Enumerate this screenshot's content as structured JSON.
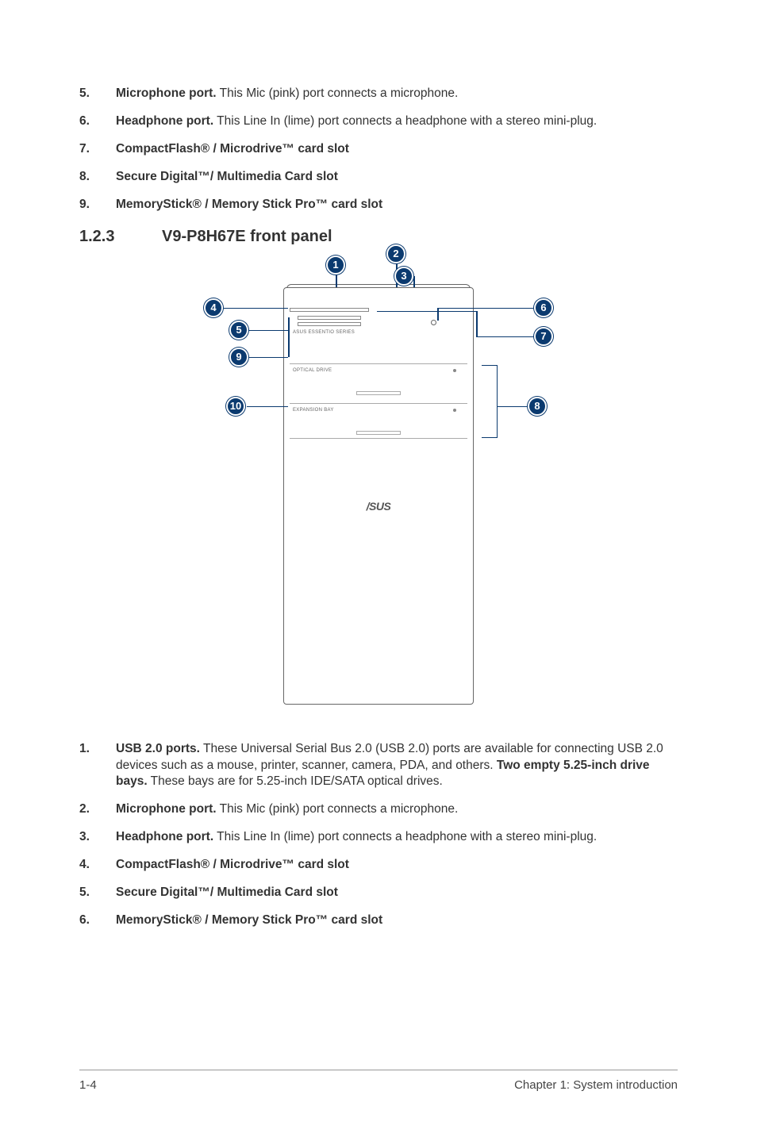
{
  "top_items": [
    {
      "num": "5.",
      "bold": "Microphone port.",
      "rest": " This Mic (pink) port connects a microphone."
    },
    {
      "num": "6.",
      "bold": "Headphone port.",
      "rest": " This Line In (lime) port connects a headphone with a stereo mini-plug."
    },
    {
      "num": "7.",
      "bold": "CompactFlash® / Microdrive™ card slot",
      "rest": ""
    },
    {
      "num": "8.",
      "bold": "Secure Digital™/ Multimedia Card slot",
      "rest": ""
    },
    {
      "num": "9.",
      "bold": "MemoryStick® / Memory Stick Pro™ card slot",
      "rest": ""
    }
  ],
  "section": {
    "num": "1.2.3",
    "title": "V9-P8H67E front panel"
  },
  "balloons": {
    "b1": "1",
    "b2": "2",
    "b3": "3",
    "b4": "4",
    "b5": "5",
    "b6": "6",
    "b7": "7",
    "b8": "8",
    "b9": "9",
    "b10": "10"
  },
  "diagram_labels": {
    "series": "ASUS ESSENTIO SERIES",
    "optical": "OPTICAL DRIVE",
    "expansion": "EXPANSION BAY",
    "logo": "/SUS"
  },
  "bottom_items": [
    {
      "num": "1.",
      "bold": "USB 2.0 ports.",
      "rest": " These Universal Serial Bus 2.0 (USB 2.0) ports are available for connecting USB 2.0 devices such as a mouse, printer, scanner, camera, PDA, and others. ",
      "bold2": "Two empty 5.25-inch drive bays.",
      "rest2": " These bays are for 5.25-inch IDE/SATA optical drives."
    },
    {
      "num": "2.",
      "bold": "Microphone port.",
      "rest": " This Mic (pink) port connects a microphone."
    },
    {
      "num": "3.",
      "bold": "Headphone port.",
      "rest": " This Line In (lime) port connects a headphone with a stereo mini-plug."
    },
    {
      "num": "4.",
      "bold": "CompactFlash® / Microdrive™ card slot",
      "rest": ""
    },
    {
      "num": "5.",
      "bold": "Secure Digital™/ Multimedia Card slot",
      "rest": ""
    },
    {
      "num": "6.",
      "bold": "MemoryStick® / Memory Stick Pro™ card slot",
      "rest": ""
    }
  ],
  "footer": {
    "left": "1-4",
    "right": "Chapter 1: System introduction"
  }
}
